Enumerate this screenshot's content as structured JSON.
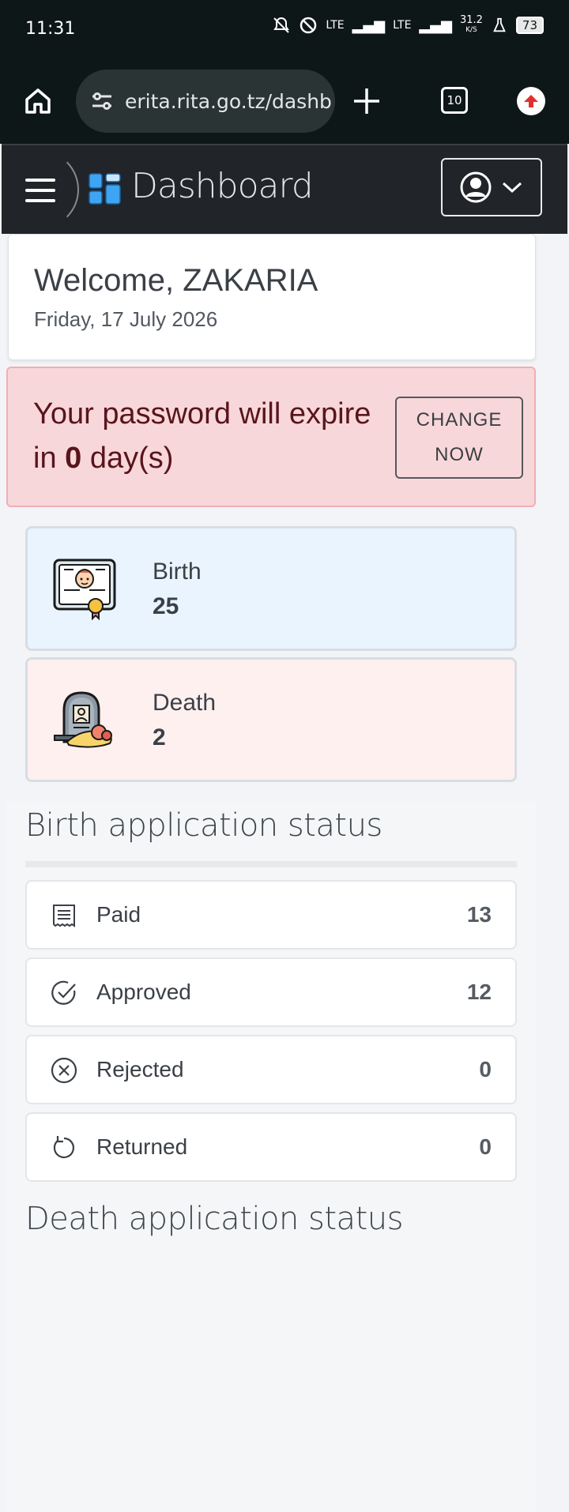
{
  "statusbar": {
    "time": "11:31",
    "network1": "LTE",
    "network2": "LTE",
    "speed": "31.2",
    "speed_unit": "K/S",
    "battery": "73"
  },
  "browser": {
    "url": "erita.rita.go.tz/dashb",
    "tab_count": "10"
  },
  "appnav": {
    "title": "Dashboard"
  },
  "welcome": {
    "greeting": "Welcome, ZAKARIA",
    "date": "Friday, 17 July 2026"
  },
  "alert": {
    "text_before": "Your password will expire in ",
    "days": "0",
    "text_after": " day(s)",
    "button_line1": "CHANGE",
    "button_line2": "NOW"
  },
  "stats": {
    "birth": {
      "label": "Birth",
      "count": "25"
    },
    "death": {
      "label": "Death",
      "count": "2"
    }
  },
  "birth_status": {
    "heading": "Birth application status",
    "rows": [
      {
        "label": "Paid",
        "value": "13",
        "icon": "receipt-icon"
      },
      {
        "label": "Approved",
        "value": "12",
        "icon": "check-circle-icon"
      },
      {
        "label": "Rejected",
        "value": "0",
        "icon": "x-circle-icon"
      },
      {
        "label": "Returned",
        "value": "0",
        "icon": "rotate-ccw-icon"
      }
    ]
  },
  "death_status": {
    "heading": "Death application status"
  },
  "colors": {
    "navbar": "#212529",
    "alert_bg": "#f8d7da",
    "birth_card": "#eaf4ff",
    "death_card": "#fff0f0"
  }
}
